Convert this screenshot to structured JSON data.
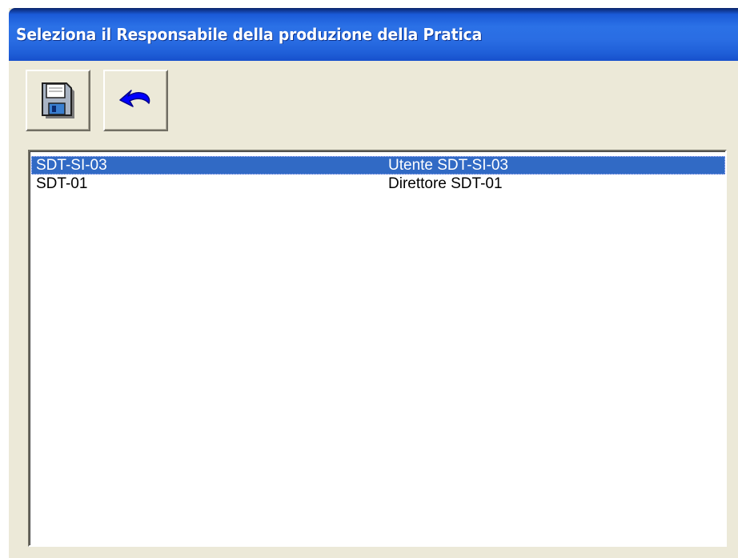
{
  "window": {
    "title": "Seleziona il Responsabile della produzione della Pratica"
  },
  "toolbar": {
    "save_icon": "floppy-disk-icon",
    "undo_icon": "undo-arrow-icon"
  },
  "colors": {
    "title_bar": "#2a6de3",
    "window_bg": "#ece9d8",
    "selection": "#316ac5"
  },
  "list": {
    "selected_index": 0,
    "rows": [
      {
        "code": "SDT-SI-03",
        "name": "Utente SDT-SI-03"
      },
      {
        "code": "SDT-01",
        "name": "Direttore SDT-01"
      }
    ]
  }
}
